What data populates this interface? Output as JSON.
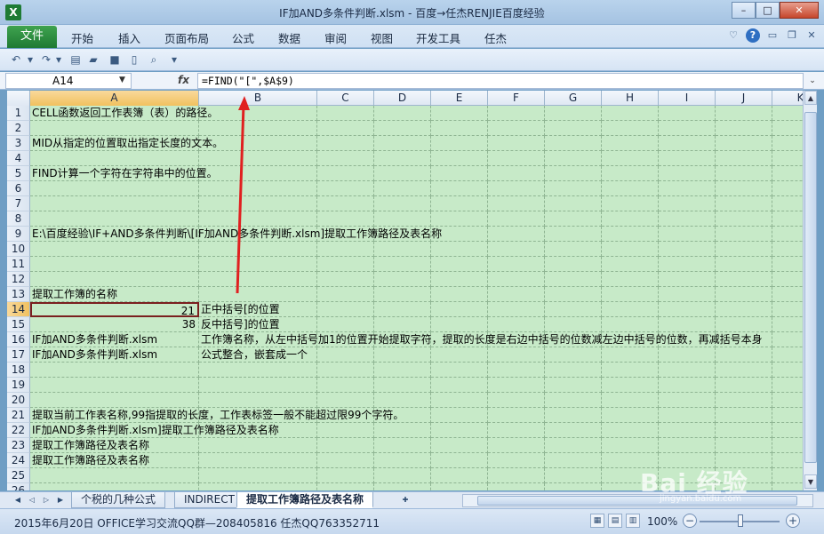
{
  "window": {
    "app_icon": "X",
    "title": "IF加AND多条件判断.xlsm  -  百度→任杰RENJIE百度经验",
    "buttons": [
      "–",
      "□",
      "✕"
    ]
  },
  "ribbon": {
    "file_tab": "文件",
    "tabs": [
      "开始",
      "插入",
      "页面布局",
      "公式",
      "数据",
      "审阅",
      "视图",
      "开发工具",
      "任杰"
    ]
  },
  "formula_bar": {
    "name_box": "A14",
    "fx": "fx",
    "formula": "=FIND(\"[\",$A$9)"
  },
  "columns": [
    "A",
    "B",
    "C",
    "D",
    "E",
    "F",
    "G",
    "H",
    "I",
    "J",
    "K"
  ],
  "active_column": "A",
  "active_row": "14",
  "rows": [
    {
      "n": "1",
      "a": "CELL函数返回工作表簿（表）的路径。",
      "b": ""
    },
    {
      "n": "2",
      "a": "",
      "b": ""
    },
    {
      "n": "3",
      "a": "MID从指定的位置取出指定长度的文本。",
      "b": ""
    },
    {
      "n": "4",
      "a": "",
      "b": ""
    },
    {
      "n": "5",
      "a": "FIND计算一个字符在字符串中的位置。",
      "b": ""
    },
    {
      "n": "6",
      "a": "",
      "b": ""
    },
    {
      "n": "7",
      "a": "",
      "b": ""
    },
    {
      "n": "8",
      "a": "",
      "b": ""
    },
    {
      "n": "9",
      "a": "E:\\百度经验\\IF+AND多条件判断\\[IF加AND多条件判断.xlsm]提取工作簿路径及表名称",
      "b": ""
    },
    {
      "n": "10",
      "a": "",
      "b": ""
    },
    {
      "n": "11",
      "a": "",
      "b": ""
    },
    {
      "n": "12",
      "a": "",
      "b": ""
    },
    {
      "n": "13",
      "a": "提取工作簿的名称",
      "b": ""
    },
    {
      "n": "14",
      "a": "21",
      "b": "正中括号[的位置"
    },
    {
      "n": "15",
      "a": "38",
      "b": "反中括号]的位置"
    },
    {
      "n": "16",
      "a": "IF加AND多条件判断.xlsm",
      "b": "工作簿名称，从左中括号加1的位置开始提取字符，提取的长度是右边中括号的位数减左边中括号的位数，再减括号本身"
    },
    {
      "n": "17",
      "a": "IF加AND多条件判断.xlsm",
      "b": "公式整合，嵌套成一个"
    },
    {
      "n": "18",
      "a": "",
      "b": ""
    },
    {
      "n": "19",
      "a": "",
      "b": ""
    },
    {
      "n": "20",
      "a": "",
      "b": ""
    },
    {
      "n": "21",
      "a": "提取当前工作表名称,99指提取的长度，工作表标签一般不能超过限99个字符。",
      "b": ""
    },
    {
      "n": "22",
      "a": "IF加AND多条件判断.xlsm]提取工作簿路径及表名称",
      "b": ""
    },
    {
      "n": "23",
      "a": "提取工作簿路径及表名称",
      "b": ""
    },
    {
      "n": "24",
      "a": "提取工作簿路径及表名称",
      "b": ""
    },
    {
      "n": "25",
      "a": "",
      "b": ""
    },
    {
      "n": "26",
      "a": "",
      "b": ""
    }
  ],
  "sheet_tabs": [
    "个税的几种公式",
    "INDIRECT",
    "提取工作簿路径及表名称"
  ],
  "active_sheet": "提取工作簿路径及表名称",
  "status": {
    "text": "2015年6月20日   OFFICE学习交流QQ群—208405816  任杰QQ763352711",
    "zoom": "100%"
  },
  "watermark": {
    "main": "Bai 经验",
    "sub": "jingyan.baidu.com"
  },
  "colors": {
    "grid_bg": "#c7eac8",
    "file_tab": "#2a8a3e",
    "annotation_arrow": "#e02020",
    "selection_border": "#7a1f1f"
  }
}
